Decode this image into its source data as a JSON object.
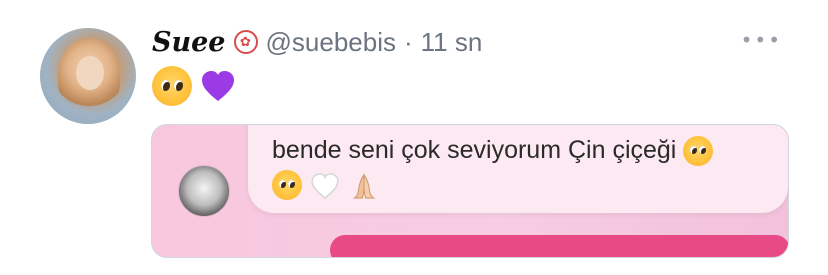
{
  "tweet": {
    "display_name": "Suee",
    "handle": "@suebebis",
    "separator": "·",
    "time": "11 sn",
    "more_icon": "more-dots-icon",
    "badge_icon": "seal-icon",
    "emojis": [
      "pleading-face-icon",
      "purple-heart-icon"
    ]
  },
  "media": {
    "message_text": "bende seni çok seviyorum Çin çiçeği",
    "message_icons": [
      "pleading-face-icon",
      "pleading-face-icon",
      "white-heart-icon",
      "folded-hands-icon"
    ],
    "colors": {
      "background": "#f6cde3",
      "bubble": "#fde9f2",
      "accent": "#e84a86"
    }
  }
}
